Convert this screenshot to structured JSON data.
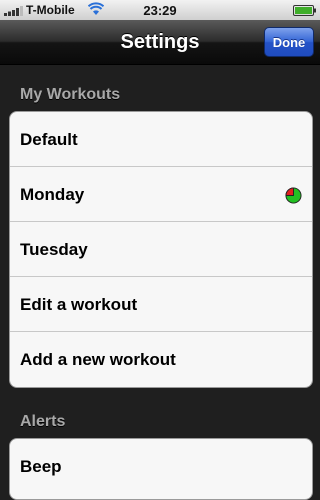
{
  "status_bar": {
    "carrier": "T-Mobile",
    "time": "23:29",
    "icons": [
      "signal-bars-icon",
      "wifi-icon",
      "battery-icon"
    ]
  },
  "nav": {
    "title": "Settings",
    "done_label": "Done"
  },
  "sections": {
    "workouts": {
      "header": "My Workouts",
      "items": [
        {
          "label": "Default"
        },
        {
          "label": "Monday",
          "icon": "progress-pie-icon",
          "icon_colors": [
            "#22c022",
            "#e02020"
          ]
        },
        {
          "label": "Tuesday"
        },
        {
          "label": "Edit a workout"
        },
        {
          "label": "Add a new workout"
        }
      ]
    },
    "alerts": {
      "header": "Alerts",
      "items": [
        {
          "label": "Beep"
        }
      ]
    }
  },
  "colors": {
    "background": "#1f1f1f",
    "done_button": "#2553c8"
  }
}
